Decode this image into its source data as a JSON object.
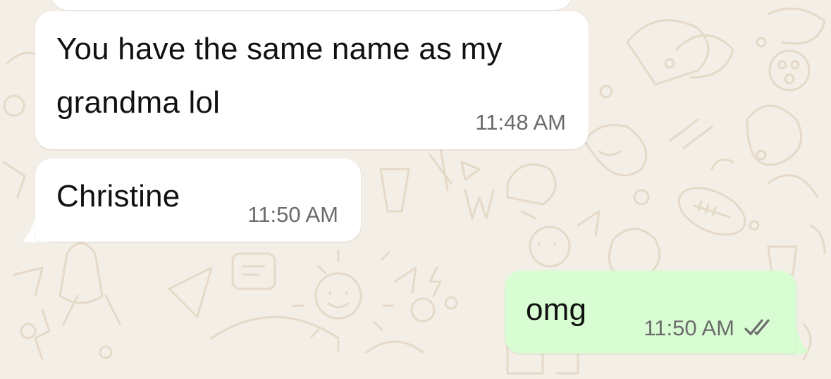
{
  "chat": {
    "wallpaper_color": "#f3efe7",
    "doodle_color": "#e4d8c6",
    "messages": [
      {
        "direction": "incoming",
        "text": "You have the same name as my\ngrandma lol",
        "time": "11:48 AM",
        "bubble_color": "#ffffff"
      },
      {
        "direction": "incoming",
        "text": "Christine",
        "time": "11:50 AM",
        "bubble_color": "#ffffff"
      },
      {
        "direction": "outgoing",
        "text": "omg",
        "time": "11:50 AM",
        "bubble_color": "#d9fdd3",
        "status_icon": "double-check-icon"
      }
    ]
  }
}
